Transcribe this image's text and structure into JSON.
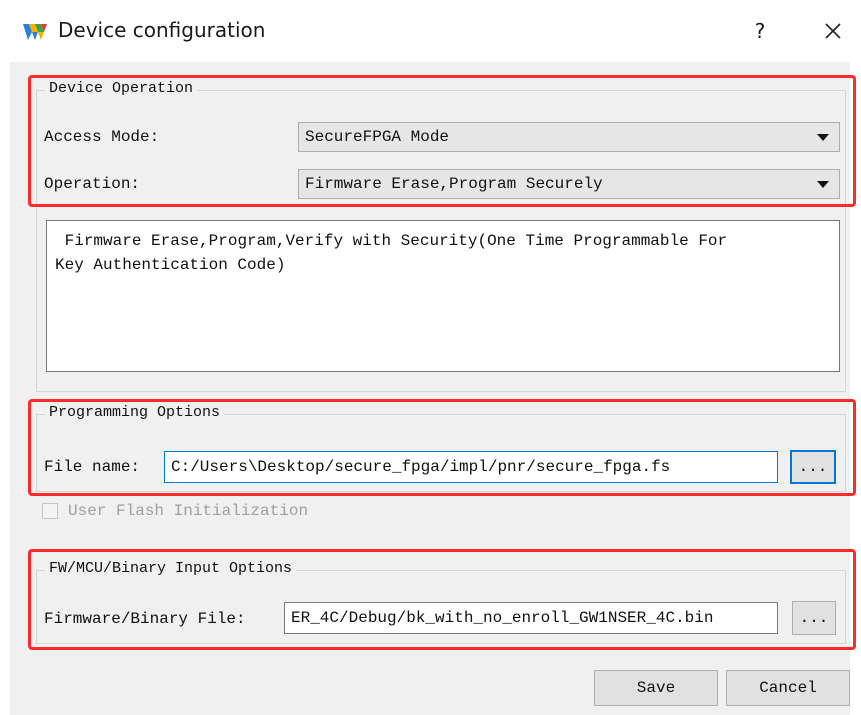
{
  "window": {
    "title": "Device configuration",
    "help_label": "?",
    "icons": {
      "app": "gowin-logo-icon",
      "close": "close-icon"
    }
  },
  "device_operation": {
    "group_title": "Device Operation",
    "access_mode_label": "Access Mode:",
    "access_mode_value": "SecureFPGA Mode",
    "operation_label": "Operation:",
    "operation_value": "Firmware Erase,Program Securely",
    "description": " Firmware Erase,Program,Verify with Security(One Time Programmable For\nKey Authentication Code)"
  },
  "programming_options": {
    "group_title": "Programming Options",
    "file_name_label": "File name:",
    "file_name_value": "C:/Users\\Desktop/secure_fpga/impl/pnr/secure_fpga.fs",
    "browse_label": "...",
    "user_flash_label": "User Flash Initialization"
  },
  "fw_options": {
    "group_title": "FW/MCU/Binary Input Options",
    "file_label": "Firmware/Binary File:",
    "file_value": "ER_4C/Debug/bk_with_no_enroll_GW1NSER_4C.bin",
    "browse_label": "..."
  },
  "buttons": {
    "save": "Save",
    "cancel": "Cancel"
  },
  "colors": {
    "highlight": "#ff2a2a",
    "focus": "#0078d7",
    "dialog_bg": "#f0f0f0"
  }
}
